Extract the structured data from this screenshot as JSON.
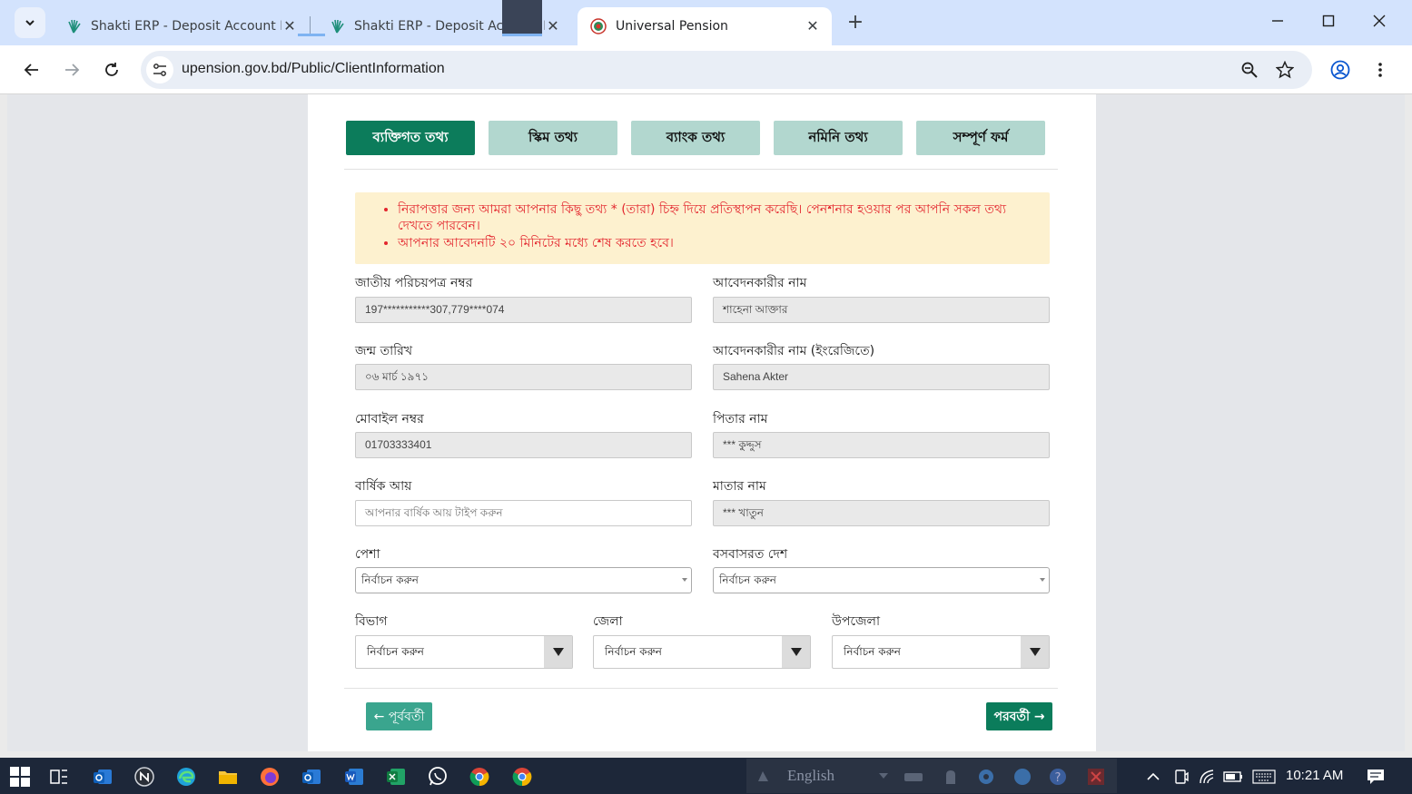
{
  "browser": {
    "tabs": [
      {
        "title": "Shakti ERP - Deposit Account In"
      },
      {
        "title": "Shakti ERP - Deposit Account D"
      },
      {
        "title": "Universal Pension"
      }
    ],
    "url": "upension.gov.bd/Public/ClientInformation"
  },
  "steps": [
    "ব্যক্তিগত তথ্য",
    "স্কিম তথ্য",
    "ব্যাংক তথ্য",
    "নমিনি তথ্য",
    "সম্পূর্ণ ফর্ম"
  ],
  "notice": [
    "নিরাপত্তার জন্য আমরা আপনার কিছু তথ্য * (তারা) চিহ্ন দিয়ে প্রতিস্থাপন করেছি। পেনশনার হওয়ার পর আপনি সকল তথ্য দেখতে পারবেন।",
    "আপনার আবেদনটি ২০ মিনিটের মধ্যে শেষ করতে হবে।"
  ],
  "form": {
    "nid": {
      "label": "জাতীয় পরিচয়পত্র নম্বর",
      "value": "197***********307,779****074"
    },
    "applicant_name": {
      "label": "আবেদনকারীর নাম",
      "value": "শাহেনা আক্তার"
    },
    "dob": {
      "label": "জন্ম তারিখ",
      "value": "০৬ মার্চ ১৯৭১"
    },
    "applicant_name_en": {
      "label": "আবেদনকারীর নাম (ইংরেজিতে)",
      "value": "Sahena Akter"
    },
    "mobile": {
      "label": "মোবাইল নম্বর",
      "value": "01703333401"
    },
    "father": {
      "label": "পিতার নাম",
      "value": "*** কুদ্দুস"
    },
    "income": {
      "label": "বার্ষিক আয়",
      "placeholder": "আপনার বার্ষিক আয় টাইপ করুন"
    },
    "mother": {
      "label": "মাতার নাম",
      "value": "*** খাতুন"
    },
    "profession": {
      "label": "পেশা",
      "value": "নির্বাচন করুন"
    },
    "country": {
      "label": "বসবাসরত দেশ",
      "value": "নির্বাচন করুন"
    },
    "division": {
      "label": "বিভাগ",
      "value": "নির্বাচন করুন"
    },
    "district": {
      "label": "জেলা",
      "value": "নির্বাচন করুন"
    },
    "upazila": {
      "label": "উপজেলা",
      "value": "নির্বাচন করুন"
    }
  },
  "buttons": {
    "prev": "← পূর্ববর্তী",
    "next": "পরবর্তী →"
  },
  "taskbar": {
    "language": "English",
    "time": "10:21 AM"
  },
  "colors": {
    "primary": "#0c7c5b",
    "step_inactive": "#b2d7cf",
    "notice_bg": "#fdf1cf",
    "notice_text": "#e3262e"
  }
}
